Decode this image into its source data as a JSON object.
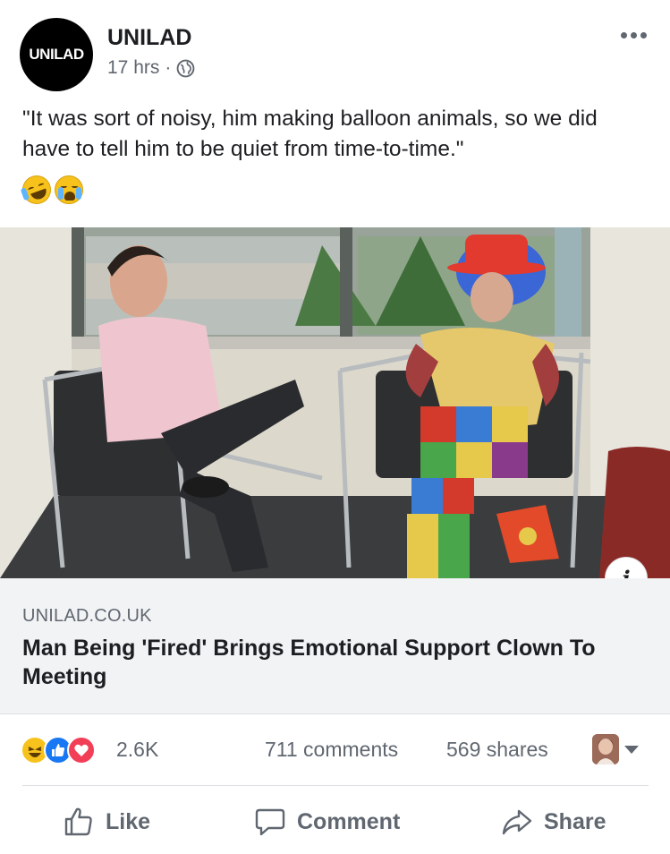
{
  "post": {
    "page_name": "UNILAD",
    "avatar_text": "UNILAD",
    "time": "17 hrs",
    "separator": "·",
    "privacy_icon": "globe-icon",
    "text": "\"It was sort of noisy, him making balloon animals, so we did have to tell him to be quiet from time-to-time.\"",
    "emojis": [
      "rolling-on-floor-laughing-emoji",
      "loudly-crying-emoji"
    ]
  },
  "link_preview": {
    "domain": "UNILAD.CO.UK",
    "title": "Man Being 'Fired' Brings Emotional Support Clown To Meeting",
    "info_icon": "i"
  },
  "stats": {
    "reactions": [
      "haha",
      "like",
      "love"
    ],
    "reaction_count": "2.6K",
    "comments": "711 comments",
    "shares": "569 shares"
  },
  "actions": {
    "like": "Like",
    "comment": "Comment",
    "share": "Share"
  },
  "colors": {
    "text": "#1c1e21",
    "secondary": "#606770",
    "link_bg": "#f2f3f5",
    "like_blue": "#1877f2",
    "love_red": "#f33e58",
    "haha_yellow": "#f7c21b"
  }
}
